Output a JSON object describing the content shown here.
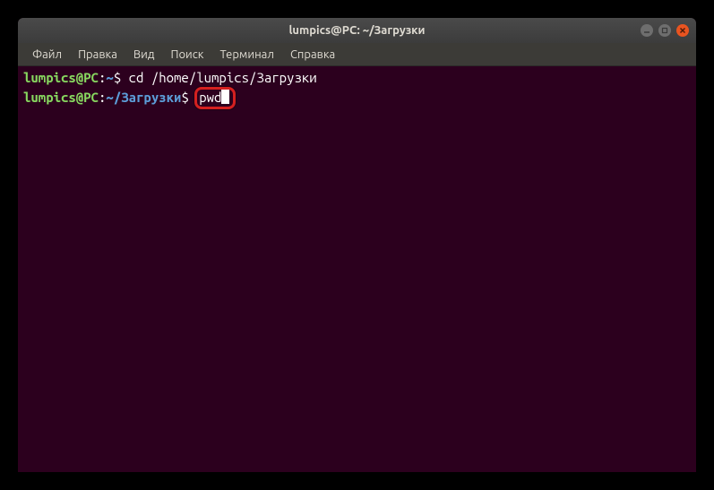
{
  "window": {
    "title": "lumpics@PC: ~/Загрузки"
  },
  "menubar": {
    "items": [
      "Файл",
      "Правка",
      "Вид",
      "Поиск",
      "Терминал",
      "Справка"
    ]
  },
  "terminal": {
    "lines": [
      {
        "user": "lumpics@PC",
        "colon": ":",
        "path": "~",
        "dollar": "$",
        "command": " cd /home/lumpics/Загрузки"
      },
      {
        "user": "lumpics@PC",
        "colon": ":",
        "path": "~/Загрузки",
        "dollar": "$",
        "highlighted_command": "pwd"
      }
    ]
  }
}
